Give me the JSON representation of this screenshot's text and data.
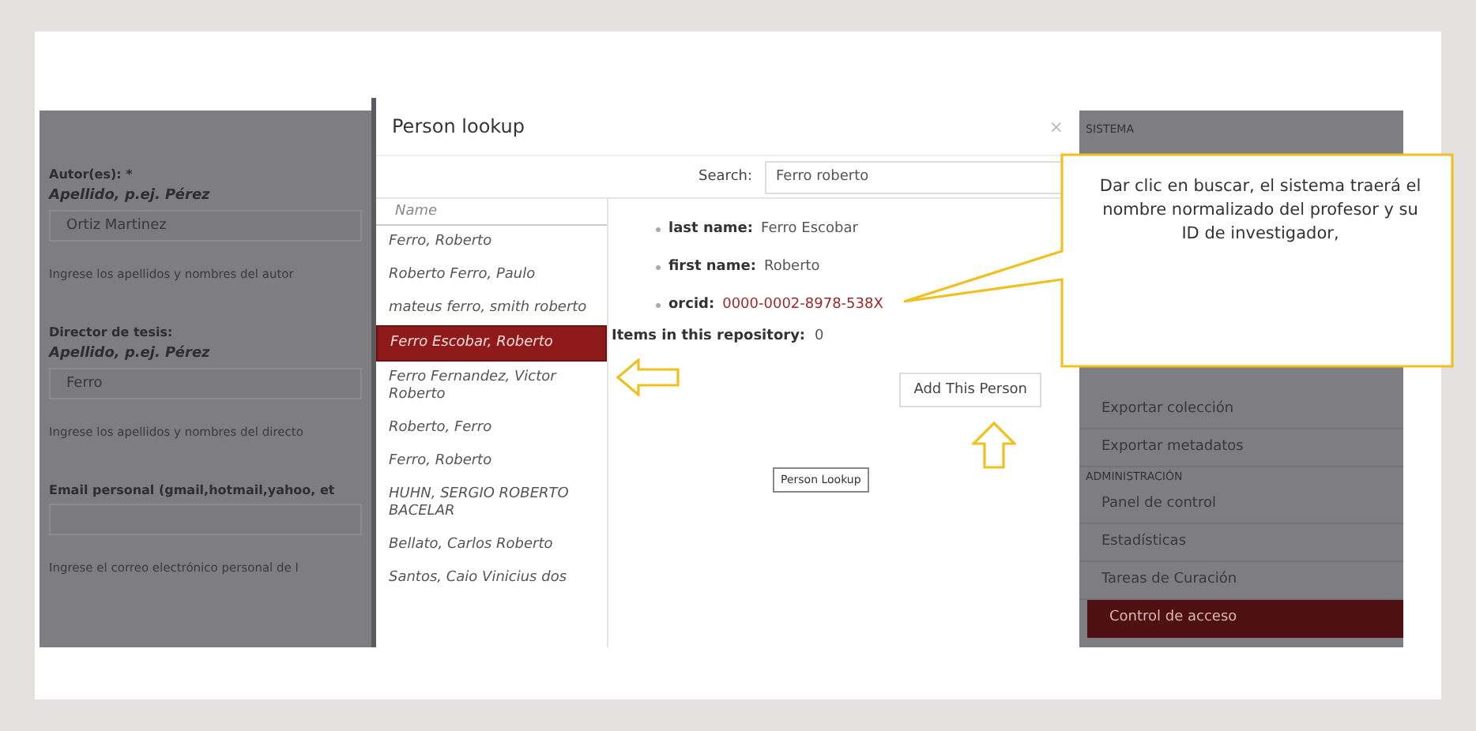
{
  "background_form": [
    {
      "kind": "label",
      "text": "Autor(es): *"
    },
    {
      "kind": "sublabel",
      "text": "Apellido, p.ej. Pérez"
    },
    {
      "kind": "field",
      "text": "Ortiz Martinez"
    },
    {
      "kind": "hint",
      "text": "Ingrese los apellidos y nombres del autor"
    },
    {
      "kind": "label",
      "text": "Director de tesis:"
    },
    {
      "kind": "sublabel",
      "text": "Apellido, p.ej. Pérez"
    },
    {
      "kind": "field",
      "text": "Ferro"
    },
    {
      "kind": "hint",
      "text": "Ingrese los apellidos y nombres del directo"
    },
    {
      "kind": "label",
      "text": "Email personal (gmail,hotmail,yahoo, et"
    },
    {
      "kind": "field"
    },
    {
      "kind": "hint",
      "text": "Ingrese el correo electrónico personal de l"
    }
  ],
  "dialog": {
    "title": "Person lookup",
    "close": "×",
    "search": {
      "label": "Search:",
      "value": "Ferro roberto"
    },
    "list": {
      "header": "Name",
      "items": [
        {
          "name": "Ferro, Roberto",
          "selected": false
        },
        {
          "name": "Roberto Ferro, Paulo",
          "selected": false
        },
        {
          "name": "mateus ferro, smith roberto",
          "selected": false
        },
        {
          "name": "Ferro Escobar, Roberto",
          "selected": true
        },
        {
          "name": "Ferro Fernandez, Victor Roberto",
          "selected": false
        },
        {
          "name": "Roberto, Ferro",
          "selected": false
        },
        {
          "name": "Ferro, Roberto",
          "selected": false
        },
        {
          "name": "HUHN, SERGIO ROBERTO BACELAR",
          "selected": false
        },
        {
          "name": "Bellato, Carlos Roberto",
          "selected": false
        },
        {
          "name": "Santos, Caio Vinicius dos",
          "selected": false
        }
      ]
    },
    "details": [
      {
        "label": "last name:",
        "value": "Ferro Escobar",
        "kind": "text"
      },
      {
        "label": "first name:",
        "value": "Roberto",
        "kind": "text"
      },
      {
        "label": "orcid:",
        "value": "0000-0002-8978-538X",
        "kind": "link"
      }
    ],
    "items_in_repository": {
      "label": "Items in this repository:",
      "value": "0"
    },
    "add_button": "Add This Person",
    "lookup_button": "Person Lookup"
  },
  "sidebar": [
    {
      "kind": "heading",
      "label": "SISTEMA"
    },
    {
      "kind": "item",
      "label": "Exportar colección",
      "selected": false
    },
    {
      "kind": "item",
      "label": "Exportar metadatos",
      "selected": false
    },
    {
      "kind": "heading",
      "label": "ADMINISTRACIÓN"
    },
    {
      "kind": "item",
      "label": "Panel de control",
      "selected": false
    },
    {
      "kind": "item",
      "label": "Estadísticas",
      "selected": false
    },
    {
      "kind": "item",
      "label": "Tareas de Curación",
      "selected": false
    },
    {
      "kind": "item",
      "label": "Control de acceso",
      "selected": true
    }
  ],
  "callout": {
    "text": "Dar clic en buscar, el sistema traerá el nombre normalizado del profesor y su ID de investigador,"
  }
}
